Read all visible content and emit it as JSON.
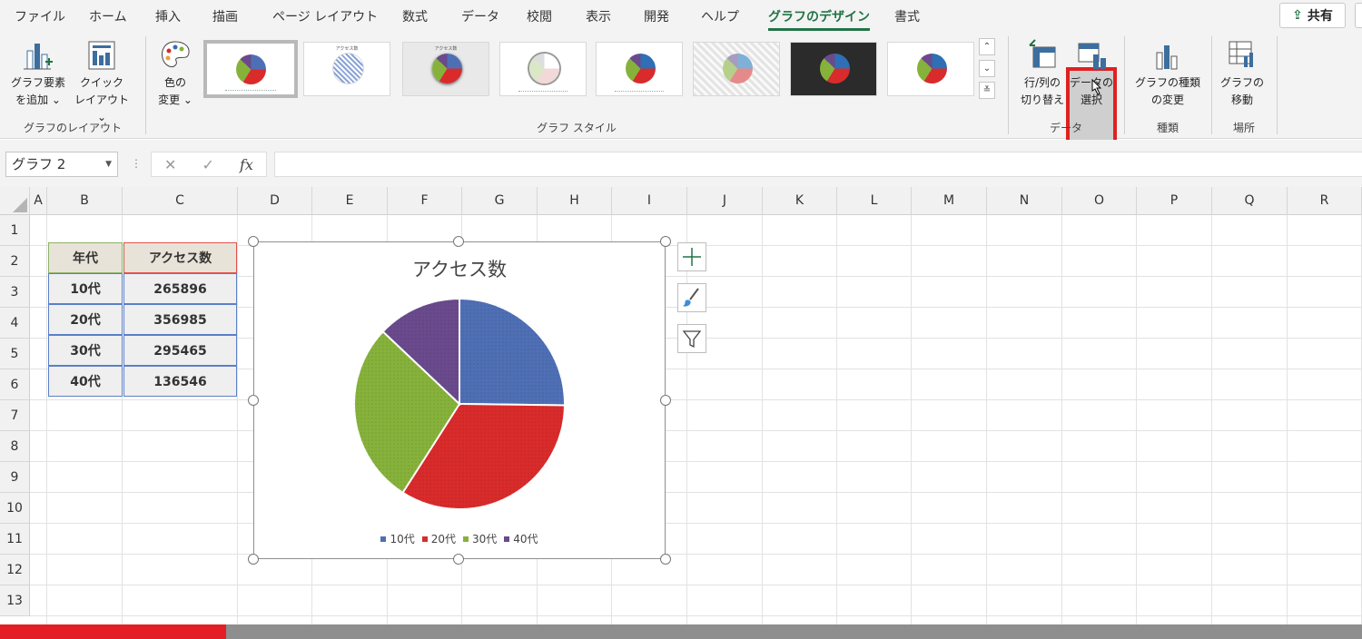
{
  "tabs": [
    "ファイル",
    "ホーム",
    "挿入",
    "描画",
    "ページ レイアウト",
    "数式",
    "データ",
    "校閲",
    "表示",
    "開発",
    "ヘルプ",
    "グラフのデザイン",
    "書式"
  ],
  "active_tab": "グラフのデザイン",
  "share_label": "共有",
  "ribbon": {
    "add_element": "グラフ要素\nを追加 ⌄",
    "quick_layout": "クイック\nレイアウト ⌄",
    "change_color": "色の\n変更 ⌄",
    "group_layout": "グラフのレイアウト",
    "group_style": "グラフ スタイル",
    "switch_row_col": "行/列の\n切り替え",
    "select_data": "データの\n選択",
    "group_data": "データ",
    "change_type": "グラフの種類\nの変更",
    "group_type": "種類",
    "move_chart": "グラフの\n移動",
    "group_location": "場所",
    "style_thumb_title": "アクセス数"
  },
  "formula_bar": {
    "name_box": "グラフ 2",
    "cancel": "✕",
    "enter": "✓",
    "fx": "fx"
  },
  "sheet": {
    "columns": [
      "A",
      "B",
      "C",
      "D",
      "E",
      "F",
      "G",
      "H",
      "I",
      "J",
      "K",
      "L",
      "M",
      "N",
      "O",
      "P",
      "Q",
      "R"
    ],
    "rows": [
      "1",
      "2",
      "3",
      "4",
      "5",
      "6",
      "7",
      "8",
      "9",
      "10",
      "11",
      "12",
      "13"
    ],
    "table_headers": [
      "年代",
      "アクセス数"
    ],
    "table_rows": [
      [
        "10代",
        "265896"
      ],
      [
        "20代",
        "356985"
      ],
      [
        "30代",
        "295465"
      ],
      [
        "40代",
        "136546"
      ]
    ]
  },
  "colors": {
    "accent": "#217346",
    "s10": "#4f6fb5",
    "s20": "#d92b2b",
    "s30": "#86b23b",
    "s40": "#6a4a8c",
    "highlight": "#e02020",
    "progress": "#e31e24"
  },
  "progress_fraction": 0.166,
  "chart_data": {
    "type": "pie",
    "title": "アクセス数",
    "categories": [
      "10代",
      "20代",
      "30代",
      "40代"
    ],
    "values": [
      265896,
      356985,
      295465,
      136546
    ],
    "legend": "bottom"
  }
}
